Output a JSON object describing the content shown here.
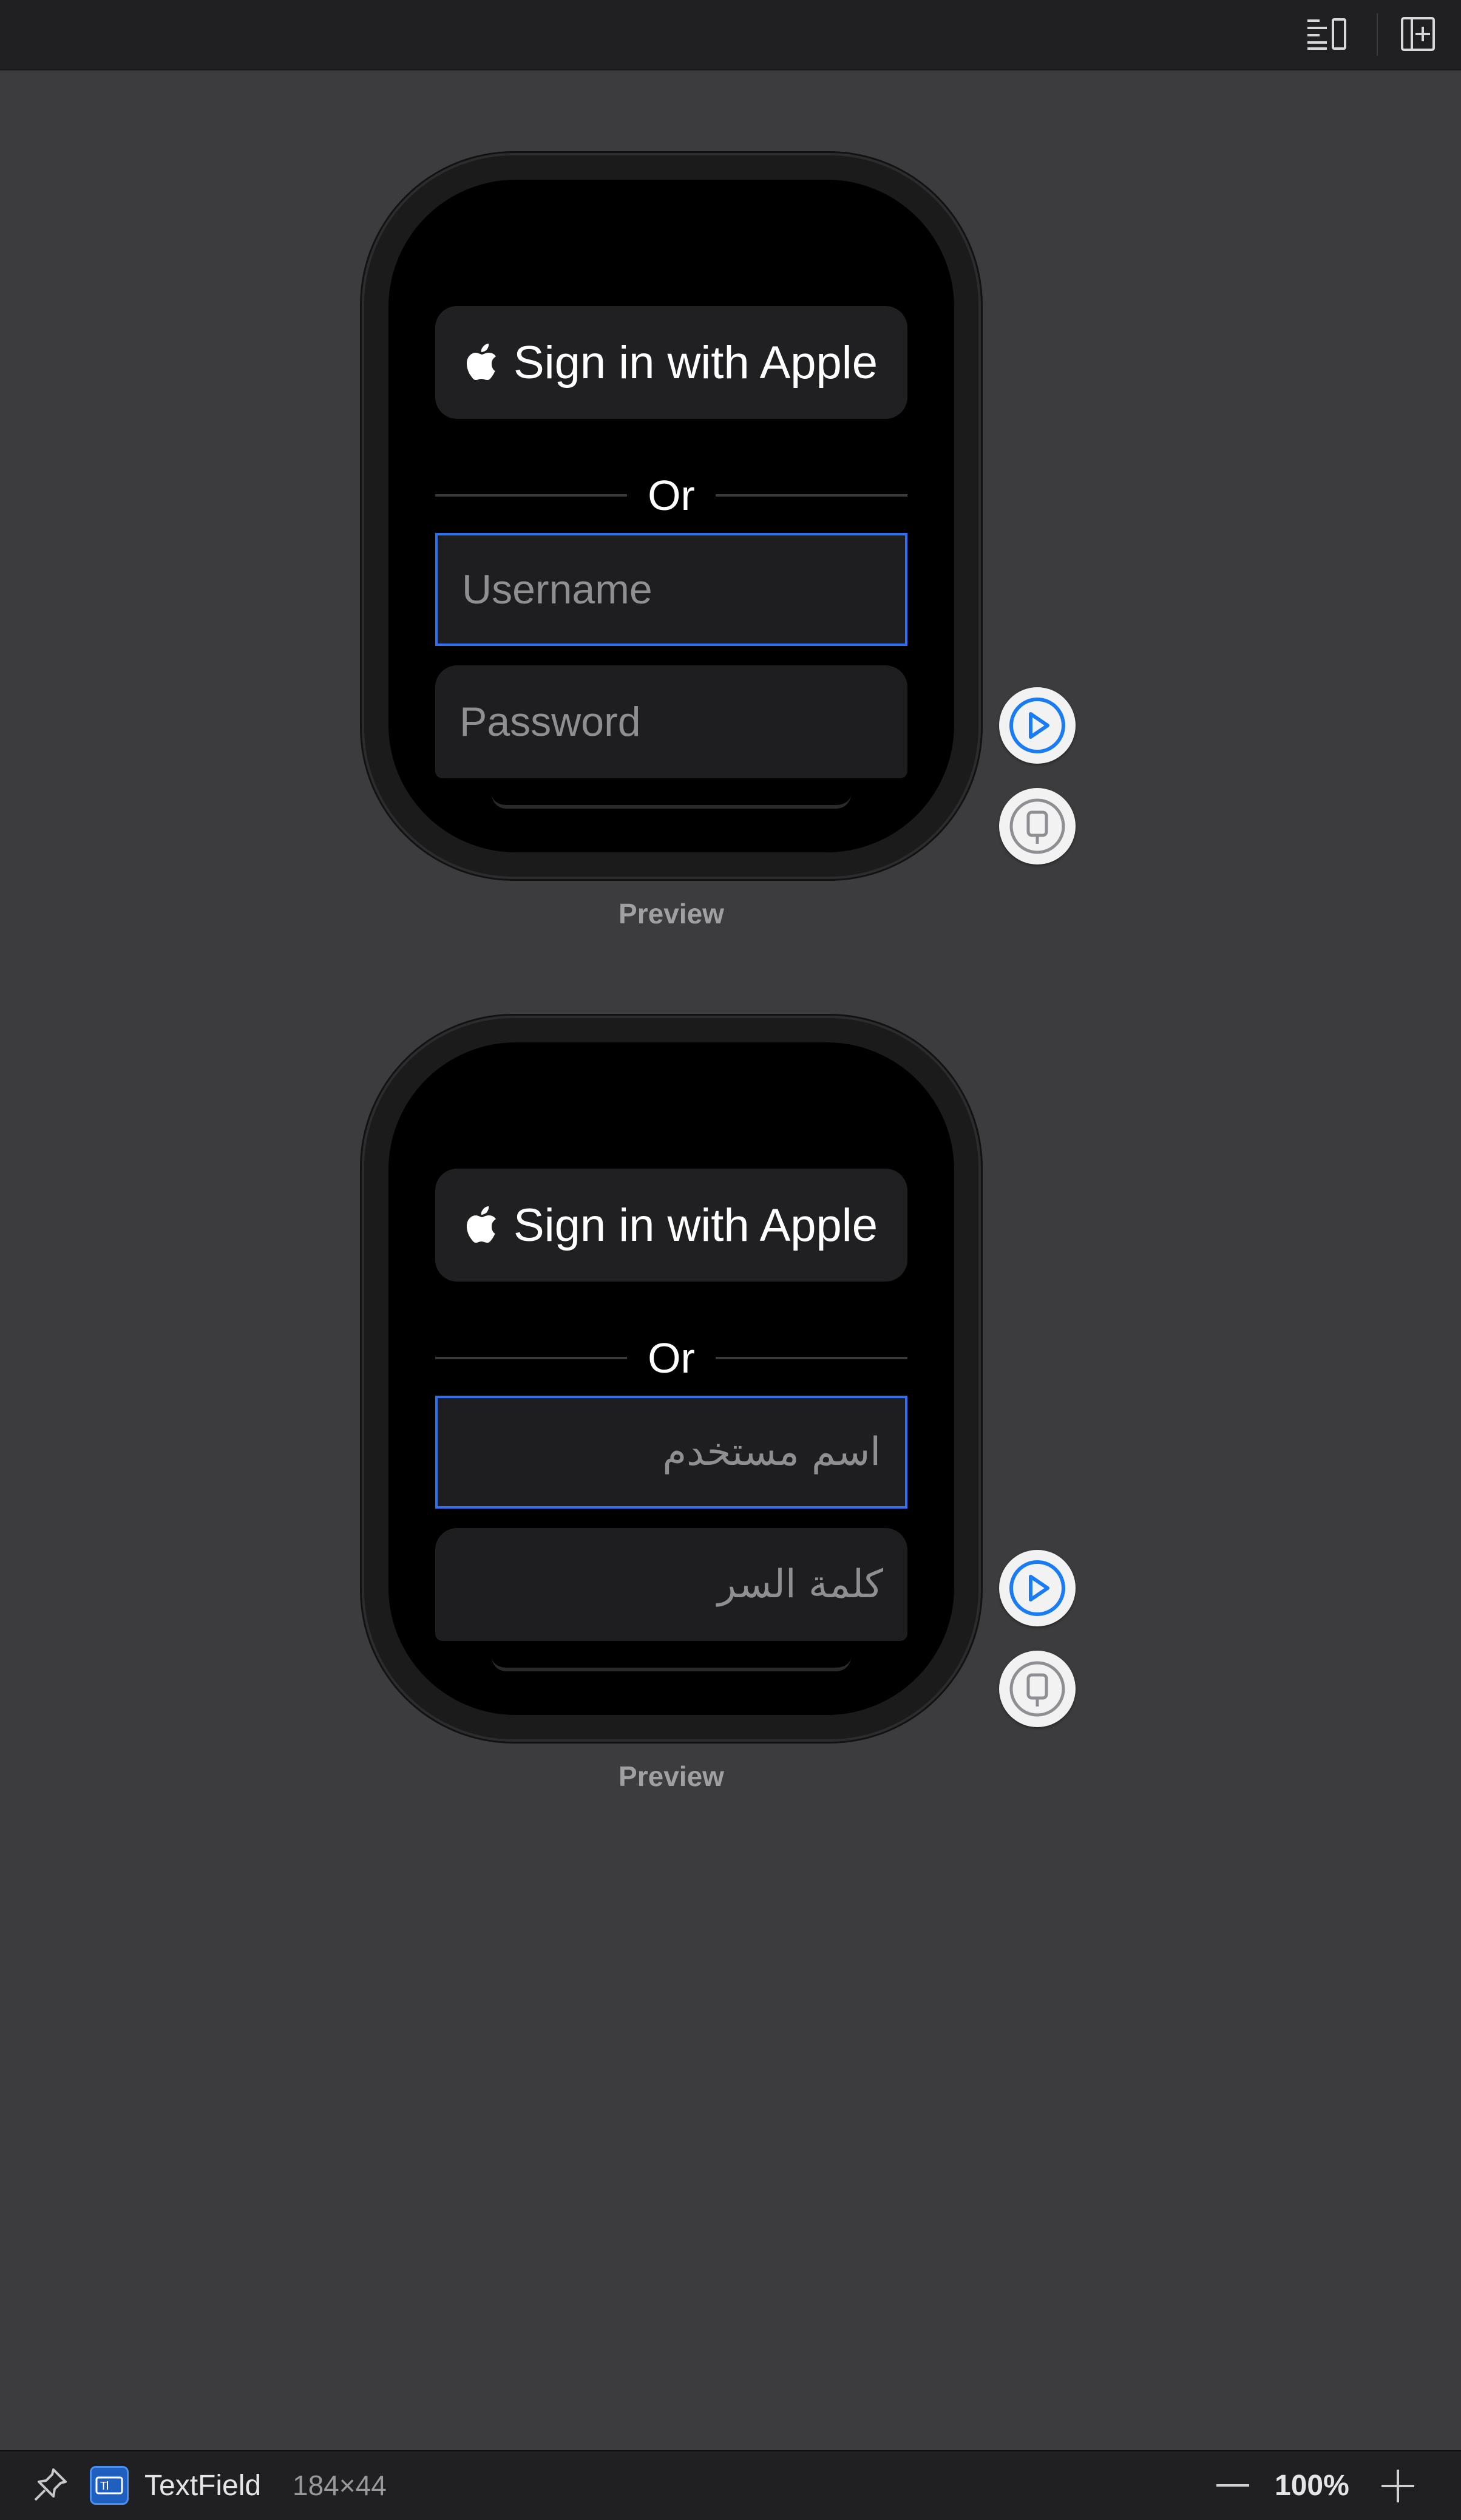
{
  "toolbar": {
    "icons": [
      "inspector-list-icon",
      "add-editor-icon"
    ]
  },
  "previews": [
    {
      "apple_button_label": "Sign in with Apple",
      "separator_text": "Or",
      "username_placeholder": "Username",
      "password_placeholder": "Password",
      "label": "Preview",
      "direction": "ltr"
    },
    {
      "apple_button_label": "Sign in with Apple",
      "separator_text": "Or",
      "username_placeholder": "اسم مستخدم",
      "password_placeholder": "كلمة السر",
      "label": "Preview",
      "direction": "rtl"
    }
  ],
  "statusbar": {
    "selected_type": "TextField",
    "selected_size": "184×44",
    "zoom": "100%"
  },
  "colors": {
    "canvas": "#3c3c3e",
    "bars": "#202023",
    "selection": "#2f6ff2",
    "accent": "#1a7cf5"
  }
}
